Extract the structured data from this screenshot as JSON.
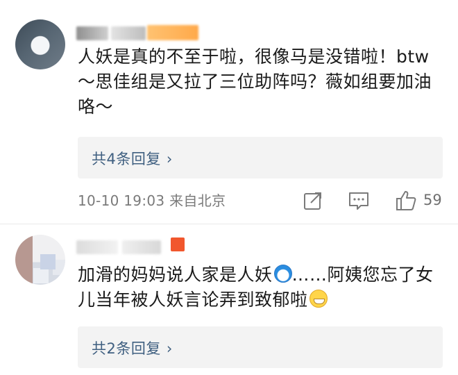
{
  "comments": [
    {
      "text": "人妖是真的不至于啦，很像马是没错啦！btw～思佳组是又拉了三位助阵吗？薇如组要加油咯～",
      "replies_label": "共4条回复",
      "time": "10-10 19:03",
      "location": "来自北京",
      "like_count": "59"
    },
    {
      "text_a": "加滑的妈妈说人家是人妖",
      "text_b": "……阿姨您忘了女儿当年被人妖言论弄到致郁啦",
      "replies_label": "共2条回复"
    }
  ],
  "icons": {
    "chevron": "chevron-right-icon",
    "share": "share-icon",
    "comment": "comment-icon",
    "like": "thumbs-up-icon",
    "emoji_1": "doraemon-emoji",
    "emoji_2": "grinning-emoji"
  },
  "colors": {
    "reply_link": "#3f5f80",
    "meta_text": "#7a7a7a",
    "reply_box": "#f3f3f3"
  }
}
